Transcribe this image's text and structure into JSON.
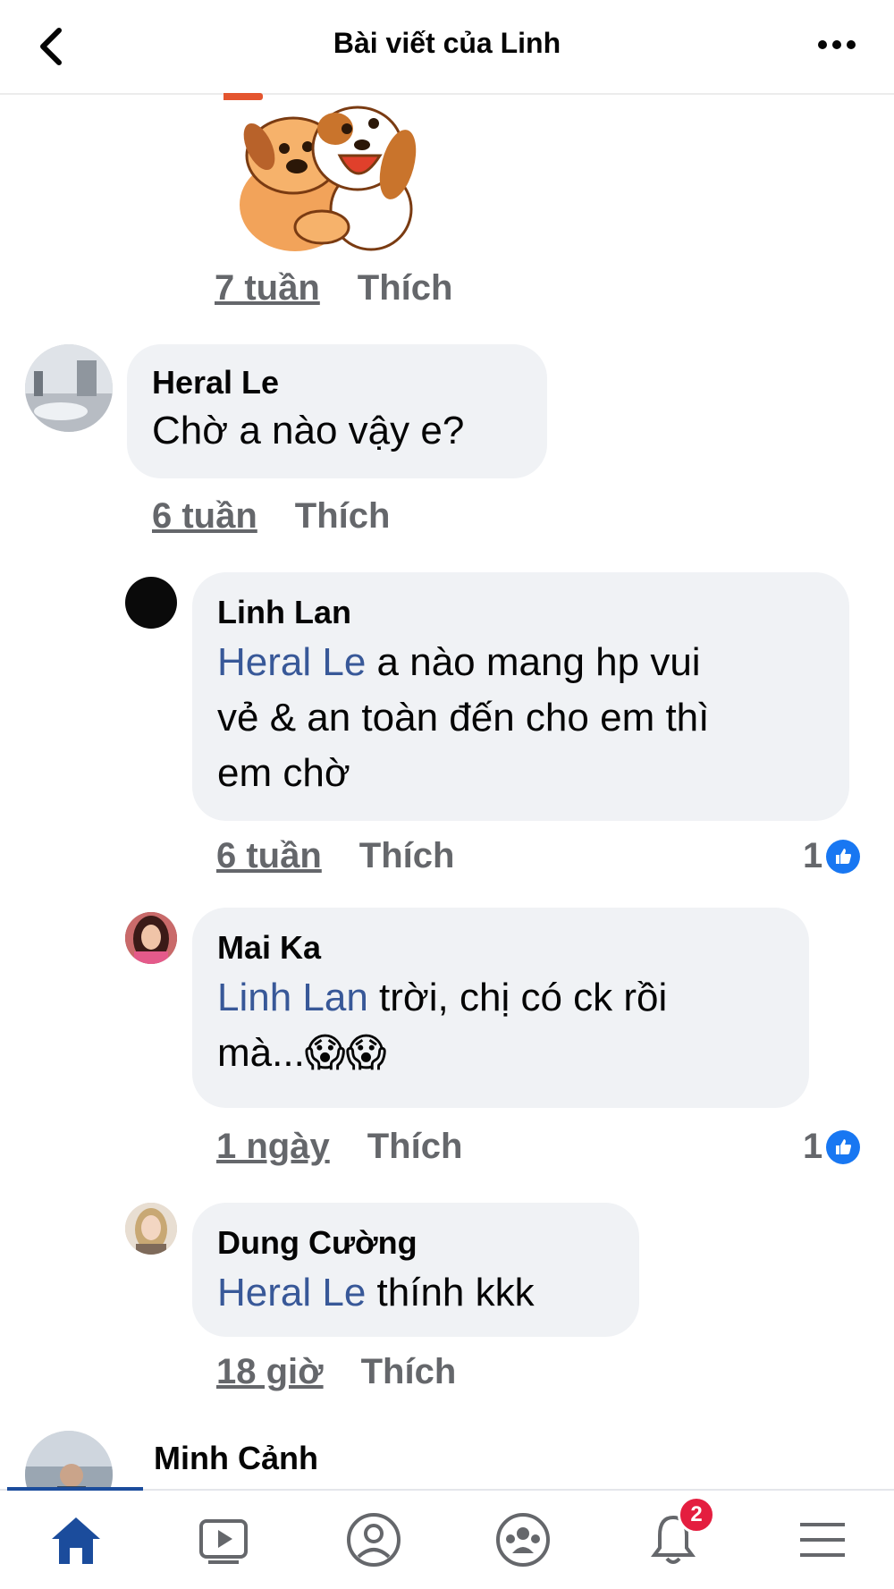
{
  "header": {
    "title": "Bài viết của Linh"
  },
  "sticker_comment": {
    "time": "7 tuần",
    "like_label": "Thích"
  },
  "comments": [
    {
      "author": "Heral Le",
      "text": "Chờ a nào vậy e?",
      "time": "6 tuần",
      "like_label": "Thích"
    },
    {
      "author": "Linh Lan",
      "mention": "Heral Le",
      "text_line1": " a nào mang hp vui",
      "text_line2": "vẻ & an toàn đến cho em thì",
      "text_line3": "em chờ",
      "time": "6 tuần",
      "like_label": "Thích",
      "reaction_count": "1"
    },
    {
      "author": "Mai Ka",
      "mention": "Linh Lan",
      "text_line1": " trời,  chị có ck rồi",
      "text_line2": "mà...😱😱",
      "time": "1 ngày",
      "like_label": "Thích",
      "reaction_count": "1"
    },
    {
      "author": "Dung Cường",
      "mention": "Heral Le",
      "text_line1": " thính kkk",
      "time": "18 giờ",
      "like_label": "Thích"
    },
    {
      "author": "Minh Cảnh"
    }
  ],
  "bottom_nav": {
    "items": [
      "home-icon",
      "video-icon",
      "profile-icon",
      "groups-icon",
      "bell-icon",
      "menu-icon"
    ],
    "notification_count": "2",
    "accent_color": "#1b4c9c"
  }
}
